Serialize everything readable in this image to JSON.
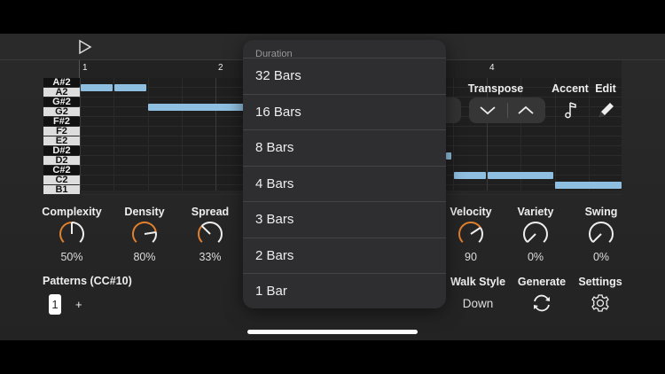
{
  "ruler": {
    "bars": [
      "1",
      "2",
      "4"
    ]
  },
  "keys": [
    {
      "n": "A#2",
      "b": true
    },
    {
      "n": "A2",
      "b": false
    },
    {
      "n": "G#2",
      "b": true
    },
    {
      "n": "G2",
      "b": false
    },
    {
      "n": "F#2",
      "b": true
    },
    {
      "n": "F2",
      "b": false
    },
    {
      "n": "E2",
      "b": false
    },
    {
      "n": "D#2",
      "b": true
    },
    {
      "n": "D2",
      "b": false
    },
    {
      "n": "C#2",
      "b": true
    },
    {
      "n": "C2",
      "b": false
    },
    {
      "n": "B1",
      "b": false
    }
  ],
  "toolbar": {
    "transpose": "Transpose",
    "accent": "Accent",
    "edit": "Edit"
  },
  "knobs": [
    {
      "label": "Complexity",
      "value": "50%",
      "fraction": 0.5
    },
    {
      "label": "Density",
      "value": "80%",
      "fraction": 0.8
    },
    {
      "label": "Spread",
      "value": "33%",
      "fraction": 0.33
    },
    {
      "label": "Velocity",
      "value": "90",
      "fraction": 0.71
    },
    {
      "label": "Variety",
      "value": "0%",
      "fraction": 0
    },
    {
      "label": "Swing",
      "value": "0%",
      "fraction": 0
    }
  ],
  "patterns": {
    "label": "Patterns (CC#10)",
    "current": "1",
    "add": "+"
  },
  "walk_style": {
    "label": "Walk Style",
    "value": "Down"
  },
  "generate": {
    "label": "Generate"
  },
  "settings": {
    "label": "Settings"
  },
  "popup": {
    "header": "Duration",
    "items": [
      "32 Bars",
      "16 Bars",
      "8 Bars",
      "4 Bars",
      "3 Bars",
      "2 Bars",
      "1 Bar"
    ]
  },
  "colors": {
    "accent": "#E0802E",
    "note": "#8FBFE0"
  }
}
